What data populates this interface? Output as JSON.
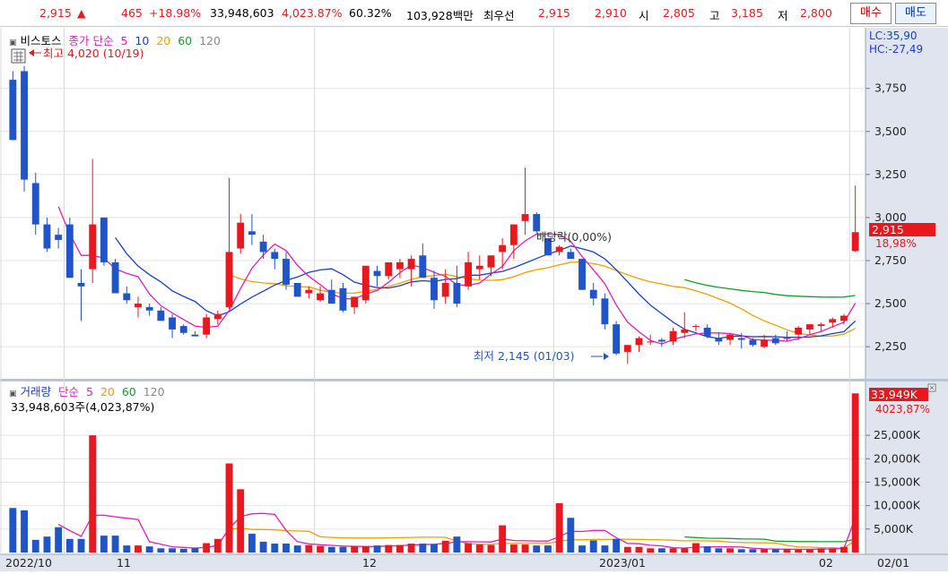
{
  "topbar": {
    "price": "2,915",
    "arrow": "▲",
    "change": "465",
    "change_rate": "+18.98%",
    "volume": "33,948,603",
    "volume_rate": "4,023.87%",
    "turnover": "60.32%",
    "amount": "103,928백만",
    "priority_sell_label": "최우선",
    "priority_sell": "2,915",
    "priority_buy": "2,910",
    "open_label": "시",
    "open": "2,805",
    "high_label": "고",
    "high": "3,185",
    "low_label": "저",
    "low": "2,800",
    "buy_button": "매수",
    "sell_button": "매도"
  },
  "price_legend": {
    "stock_name": "비스토스",
    "ma_label": "종가 단순",
    "ma5": "5",
    "ma10": "10",
    "ma20": "20",
    "ma60": "60",
    "ma120": "120",
    "lc": "LC:35,90",
    "hc": "HC:-27,49"
  },
  "annotations": {
    "high_marker": "최고 4,020 (10/19)",
    "low_marker": "최저 2,145 (01/03)",
    "dividend": "배당락(0,00%)",
    "current_price": "2,915",
    "current_rate": "18,98%",
    "current_volume": "33,949K",
    "current_volume_rate": "4023,87%"
  },
  "volume_legend": {
    "label": "거래량",
    "ma_label": "단순",
    "ma5": "5",
    "ma20": "20",
    "ma60": "60",
    "ma120": "120",
    "info": "33,948,603주(4,023,87%)"
  },
  "price_axis": [
    "3,750",
    "3,500",
    "3,250",
    "3,000",
    "2,750",
    "2,500",
    "2,250"
  ],
  "volume_axis": [
    "25,000K",
    "20,000K",
    "15,000K",
    "10,000K",
    "5,000K"
  ],
  "x_axis": [
    "2022/10",
    "11",
    "12",
    "2023/01",
    "02",
    "02/01"
  ],
  "colors": {
    "up": "#e8181e",
    "down": "#1f55c8",
    "ma5": "#e020c0",
    "ma10": "#1a3fcf",
    "ma20": "#f0a000",
    "ma60": "#10a030",
    "ma120": "#888888"
  },
  "chart_data": {
    "type": "candlestick",
    "ohlc": [
      [
        3800,
        3850,
        3450,
        3450
      ],
      [
        3850,
        3880,
        3150,
        3220
      ],
      [
        3200,
        3260,
        2900,
        2960
      ],
      [
        2960,
        3000,
        2800,
        2820
      ],
      [
        2900,
        2940,
        2820,
        2870
      ],
      [
        2960,
        3000,
        2650,
        2650
      ],
      [
        2620,
        2700,
        2400,
        2600
      ],
      [
        2700,
        3340,
        2620,
        2960
      ],
      [
        3000,
        3000,
        2720,
        2740
      ],
      [
        2740,
        2760,
        2600,
        2560
      ],
      [
        2560,
        2600,
        2500,
        2520
      ],
      [
        2480,
        2540,
        2420,
        2500
      ],
      [
        2480,
        2500,
        2430,
        2460
      ],
      [
        2460,
        2480,
        2400,
        2400
      ],
      [
        2420,
        2440,
        2300,
        2350
      ],
      [
        2370,
        2380,
        2320,
        2330
      ],
      [
        2320,
        2340,
        2310,
        2310
      ],
      [
        2320,
        2440,
        2300,
        2420
      ],
      [
        2410,
        2460,
        2380,
        2440
      ],
      [
        2480,
        3230,
        2470,
        2800
      ],
      [
        2820,
        3020,
        2790,
        2970
      ],
      [
        2920,
        3020,
        2840,
        2900
      ],
      [
        2860,
        2900,
        2760,
        2800
      ],
      [
        2800,
        2820,
        2700,
        2760
      ],
      [
        2760,
        2800,
        2580,
        2610
      ],
      [
        2620,
        2620,
        2540,
        2540
      ],
      [
        2560,
        2600,
        2530,
        2580
      ],
      [
        2520,
        2600,
        2510,
        2560
      ],
      [
        2580,
        2640,
        2500,
        2500
      ],
      [
        2590,
        2620,
        2450,
        2460
      ],
      [
        2480,
        2520,
        2440,
        2540
      ],
      [
        2520,
        2720,
        2500,
        2720
      ],
      [
        2690,
        2720,
        2600,
        2660
      ],
      [
        2660,
        2720,
        2640,
        2740
      ],
      [
        2700,
        2760,
        2650,
        2740
      ],
      [
        2700,
        2780,
        2600,
        2760
      ],
      [
        2780,
        2850,
        2650,
        2650
      ],
      [
        2650,
        2690,
        2470,
        2520
      ],
      [
        2540,
        2700,
        2500,
        2620
      ],
      [
        2620,
        2720,
        2480,
        2500
      ],
      [
        2600,
        2800,
        2580,
        2740
      ],
      [
        2700,
        2780,
        2640,
        2720
      ],
      [
        2710,
        2780,
        2660,
        2780
      ],
      [
        2800,
        2880,
        2700,
        2840
      ],
      [
        2840,
        2920,
        2760,
        2960
      ],
      [
        2980,
        3290,
        2900,
        3020
      ],
      [
        3020,
        3030,
        2910,
        2920
      ],
      [
        2880,
        2880,
        2780,
        2780
      ],
      [
        2800,
        2840,
        2780,
        2830
      ],
      [
        2800,
        2820,
        2760,
        2760
      ],
      [
        2760,
        2760,
        2580,
        2580
      ],
      [
        2580,
        2620,
        2490,
        2530
      ],
      [
        2530,
        2560,
        2350,
        2380
      ],
      [
        2380,
        2400,
        2200,
        2210
      ],
      [
        2220,
        2260,
        2150,
        2260
      ],
      [
        2260,
        2310,
        2220,
        2300
      ],
      [
        2280,
        2320,
        2260,
        2280
      ],
      [
        2290,
        2300,
        2250,
        2280
      ],
      [
        2280,
        2360,
        2260,
        2340
      ],
      [
        2330,
        2450,
        2300,
        2350
      ],
      [
        2370,
        2380,
        2340,
        2370
      ],
      [
        2360,
        2380,
        2300,
        2310
      ],
      [
        2300,
        2330,
        2260,
        2280
      ],
      [
        2290,
        2330,
        2260,
        2320
      ],
      [
        2300,
        2330,
        2240,
        2290
      ],
      [
        2290,
        2300,
        2250,
        2260
      ],
      [
        2250,
        2320,
        2240,
        2290
      ],
      [
        2300,
        2320,
        2260,
        2270
      ],
      [
        2300,
        2340,
        2280,
        2300
      ],
      [
        2320,
        2370,
        2290,
        2360
      ],
      [
        2350,
        2380,
        2320,
        2380
      ],
      [
        2370,
        2390,
        2340,
        2380
      ],
      [
        2390,
        2420,
        2360,
        2410
      ],
      [
        2400,
        2440,
        2380,
        2430
      ],
      [
        2805,
        3185,
        2800,
        2915
      ]
    ],
    "volume_k": [
      9500,
      9000,
      2700,
      3400,
      5400,
      2900,
      2900,
      25000,
      3600,
      3600,
      1500,
      1500,
      1300,
      900,
      900,
      800,
      900,
      2000,
      2900,
      19000,
      13500,
      4000,
      2300,
      1900,
      1900,
      1500,
      1600,
      1400,
      1200,
      1200,
      1300,
      1300,
      1500,
      1600,
      1600,
      1900,
      1900,
      1800,
      2500,
      3400,
      2000,
      1700,
      1600,
      5800,
      1700,
      1700,
      1500,
      1500,
      10500,
      7400,
      1500,
      2600,
      1500,
      2900,
      1200,
      1200,
      900,
      900,
      900,
      900,
      2000,
      1300,
      900,
      900,
      700,
      700,
      700,
      700,
      700,
      600,
      700,
      900,
      900,
      1200,
      33949
    ],
    "price_ylim": [
      2100,
      4050
    ],
    "volume_ylim": [
      0,
      34000
    ]
  }
}
